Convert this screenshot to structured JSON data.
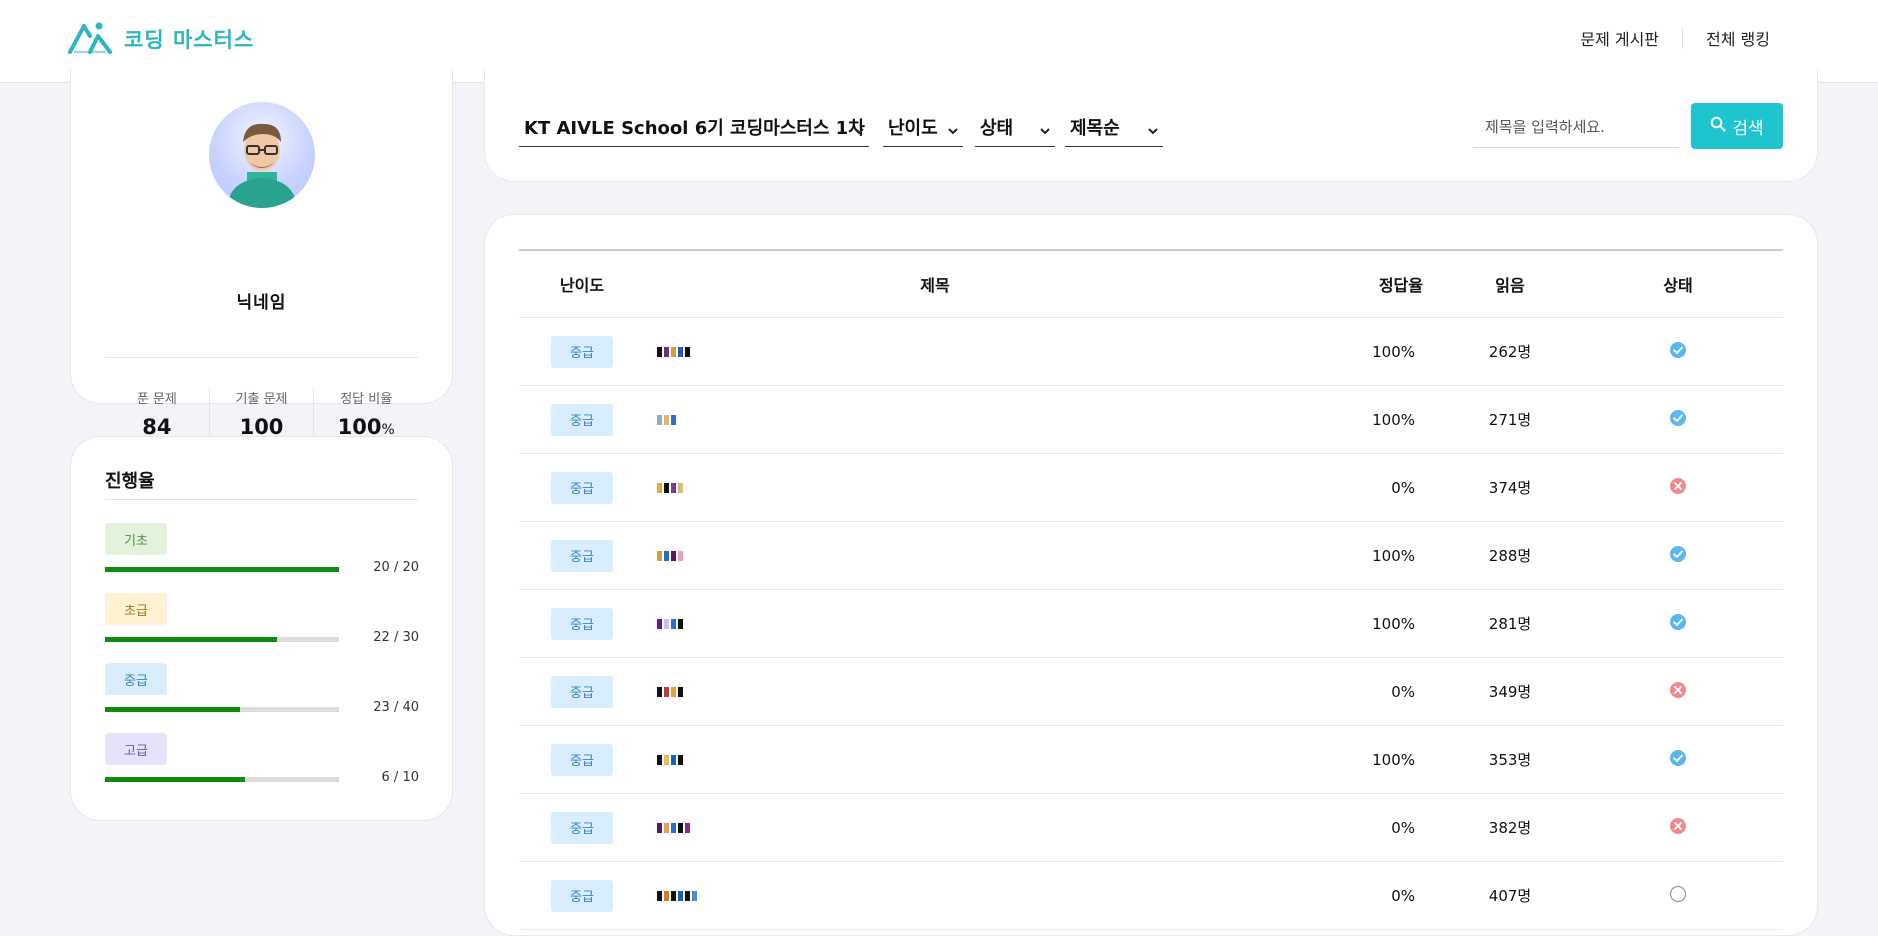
{
  "brand": {
    "name": "코딩 마스터스",
    "color": "#2bb6c0"
  },
  "nav": {
    "items": [
      "문제 게시판",
      "전체 랭킹"
    ]
  },
  "profile": {
    "username": "닉네임",
    "stats": [
      {
        "label": "푼 문제",
        "value": "84",
        "unit": ""
      },
      {
        "label": "기출 문제",
        "value": "100",
        "unit": ""
      },
      {
        "label": "정답 비율",
        "value": "100",
        "unit": "%"
      }
    ]
  },
  "progress": {
    "title": "진행율",
    "levels": [
      {
        "label": "기초",
        "done": 20,
        "total": 20,
        "count": "20 / 20",
        "bg": "#e3f2dc",
        "fg": "#5a8a4a"
      },
      {
        "label": "초급",
        "done": 22,
        "total": 30,
        "count": "22 / 30",
        "bg": "#fdf3d2",
        "fg": "#9b7a21"
      },
      {
        "label": "중급",
        "done": 23,
        "total": 40,
        "count": "23 / 40",
        "bg": "#d8eefe",
        "fg": "#3a86b5"
      },
      {
        "label": "고급",
        "done": 6,
        "total": 10,
        "count": "6 / 10",
        "bg": "#e6e2fb",
        "fg": "#6a5cb0"
      }
    ],
    "bar_color": "#118a11"
  },
  "filters": {
    "course": "KT AIVLE School 6기 코딩마스터스 1차",
    "difficulty": "난이도",
    "status": "상태",
    "sort": "제목순",
    "search_placeholder": "제목을 입력하세요.",
    "search_button": "검색",
    "accent": "#1ec5cf"
  },
  "table": {
    "headers": {
      "difficulty": "난이도",
      "title": "제목",
      "rate": "정답율",
      "read": "읽음",
      "status": "상태"
    },
    "rows": [
      {
        "difficulty": "중급",
        "rate": "100%",
        "read": "262명",
        "status": "solved"
      },
      {
        "difficulty": "중급",
        "rate": "100%",
        "read": "271명",
        "status": "solved"
      },
      {
        "difficulty": "중급",
        "rate": "0%",
        "read": "374명",
        "status": "failed"
      },
      {
        "difficulty": "중급",
        "rate": "100%",
        "read": "288명",
        "status": "solved"
      },
      {
        "difficulty": "중급",
        "rate": "100%",
        "read": "281명",
        "status": "solved"
      },
      {
        "difficulty": "중급",
        "rate": "0%",
        "read": "349명",
        "status": "failed"
      },
      {
        "difficulty": "중급",
        "rate": "100%",
        "read": "353명",
        "status": "solved"
      },
      {
        "difficulty": "중급",
        "rate": "0%",
        "read": "382명",
        "status": "failed"
      },
      {
        "difficulty": "중급",
        "rate": "0%",
        "read": "407명",
        "status": "unsolved"
      }
    ]
  },
  "status_colors": {
    "solved": "#5bb7ee",
    "failed": "#ef8b8b",
    "unsolved": "#9a9a9a"
  }
}
